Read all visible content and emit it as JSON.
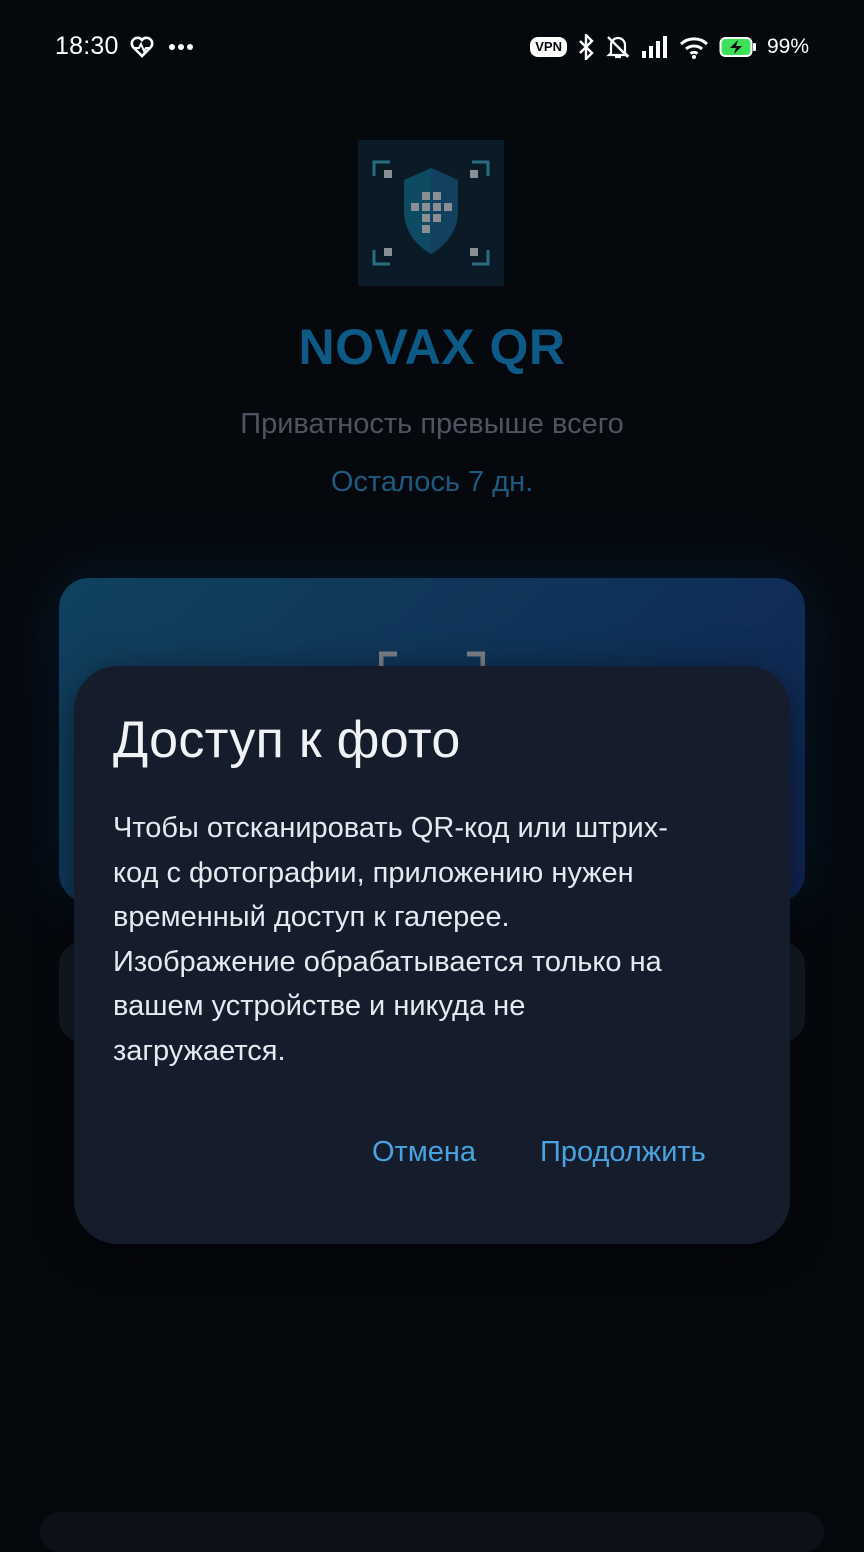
{
  "status_bar": {
    "time": "18:30",
    "vpn_label": "VPN",
    "battery_percent": "99%",
    "icons": [
      "heart-rate-icon",
      "more-dots-icon",
      "vpn-badge",
      "bluetooth-icon",
      "mute-icon",
      "signal-icon",
      "wifi-icon",
      "battery-charging-icon"
    ]
  },
  "app": {
    "title": "NOVAX QR",
    "tagline": "Приватность превыше всего",
    "trial_remaining": "Осталось 7 дн.",
    "logo_icon": "shield-qr-scan-icon",
    "colors": {
      "title": "#0e5a86",
      "accent": "#4aa3e0",
      "dialog_bg": "#151c2b",
      "page_bg": "#05080d"
    }
  },
  "dialog": {
    "title": "Доступ к фото",
    "message_lines": [
      "Чтобы отсканировать QR-код или штрих-",
      "код с фотографии, приложению нужен",
      "временный доступ к галерее.",
      "Изображение обрабатывается только на",
      "вашем устройстве и никуда не",
      "загружается."
    ],
    "cancel_label": "Отмена",
    "continue_label": "Продолжить"
  }
}
